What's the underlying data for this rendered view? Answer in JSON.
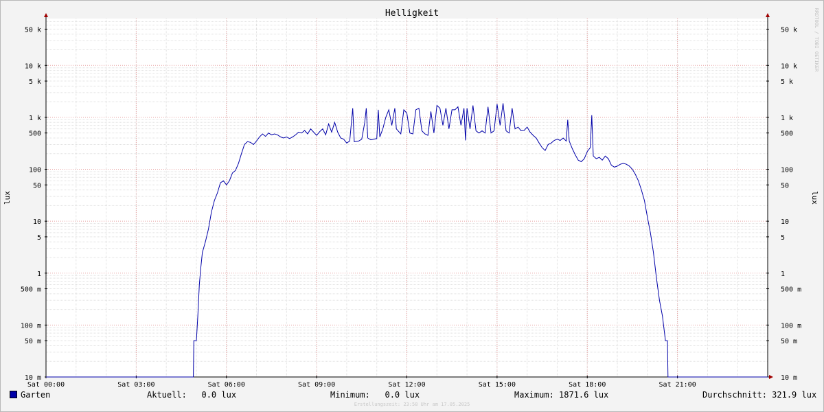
{
  "chart_data": {
    "type": "line",
    "title": "Helligkeit",
    "ylabel": "lux",
    "ylabel_right": "lux",
    "y_scale": "log",
    "ylim": [
      0.01,
      80000
    ],
    "xlim": [
      "00:00",
      "24:00"
    ],
    "x_ticks": [
      "Sat 00:00",
      "Sat 03:00",
      "Sat 06:00",
      "Sat 09:00",
      "Sat 12:00",
      "Sat 15:00",
      "Sat 18:00",
      "Sat 21:00"
    ],
    "x_tick_hours": [
      0,
      3,
      6,
      9,
      12,
      15,
      18,
      21
    ],
    "y_ticks": [
      {
        "value": 0.01,
        "label": "10 m"
      },
      {
        "value": 0.05,
        "label": "50 m"
      },
      {
        "value": 0.1,
        "label": "100 m"
      },
      {
        "value": 0.5,
        "label": "500 m"
      },
      {
        "value": 1,
        "label": "1"
      },
      {
        "value": 5,
        "label": "5"
      },
      {
        "value": 10,
        "label": "10"
      },
      {
        "value": 50,
        "label": "50"
      },
      {
        "value": 100,
        "label": "100"
      },
      {
        "value": 500,
        "label": "500"
      },
      {
        "value": 1000,
        "label": "1 k"
      },
      {
        "value": 5000,
        "label": "5 k"
      },
      {
        "value": 10000,
        "label": "10 k"
      },
      {
        "value": 50000,
        "label": "50 k"
      }
    ],
    "grid": true,
    "series": [
      {
        "name": "Garten",
        "color": "#0000a8",
        "points": [
          [
            "00:00",
            0.0
          ],
          [
            "04:54",
            0.0
          ],
          [
            "04:55",
            0.05
          ],
          [
            "05:00",
            0.05
          ],
          [
            "05:03",
            0.15
          ],
          [
            "05:06",
            0.6
          ],
          [
            "05:09",
            1.3
          ],
          [
            "05:12",
            2.5
          ],
          [
            "05:18",
            4
          ],
          [
            "05:24",
            7
          ],
          [
            "05:30",
            15
          ],
          [
            "05:36",
            25
          ],
          [
            "05:42",
            35
          ],
          [
            "05:48",
            55
          ],
          [
            "05:54",
            60
          ],
          [
            "06:00",
            50
          ],
          [
            "06:06",
            60
          ],
          [
            "06:12",
            85
          ],
          [
            "06:18",
            95
          ],
          [
            "06:24",
            130
          ],
          [
            "06:30",
            200
          ],
          [
            "06:36",
            300
          ],
          [
            "06:42",
            340
          ],
          [
            "06:48",
            330
          ],
          [
            "06:54",
            300
          ],
          [
            "07:00",
            350
          ],
          [
            "07:06",
            420
          ],
          [
            "07:12",
            480
          ],
          [
            "07:18",
            430
          ],
          [
            "07:24",
            500
          ],
          [
            "07:30",
            460
          ],
          [
            "07:36",
            480
          ],
          [
            "07:42",
            460
          ],
          [
            "07:48",
            420
          ],
          [
            "07:54",
            400
          ],
          [
            "08:00",
            420
          ],
          [
            "08:06",
            390
          ],
          [
            "08:12",
            420
          ],
          [
            "08:18",
            460
          ],
          [
            "08:24",
            520
          ],
          [
            "08:30",
            500
          ],
          [
            "08:36",
            560
          ],
          [
            "08:42",
            480
          ],
          [
            "08:48",
            600
          ],
          [
            "08:54",
            520
          ],
          [
            "09:00",
            450
          ],
          [
            "09:06",
            530
          ],
          [
            "09:12",
            600
          ],
          [
            "09:18",
            460
          ],
          [
            "09:24",
            750
          ],
          [
            "09:30",
            520
          ],
          [
            "09:36",
            800
          ],
          [
            "09:42",
            520
          ],
          [
            "09:48",
            400
          ],
          [
            "09:54",
            380
          ],
          [
            "10:00",
            320
          ],
          [
            "10:06",
            350
          ],
          [
            "10:12",
            1500
          ],
          [
            "10:15",
            340
          ],
          [
            "10:24",
            350
          ],
          [
            "10:30",
            380
          ],
          [
            "10:36",
            800
          ],
          [
            "10:39",
            1500
          ],
          [
            "10:42",
            400
          ],
          [
            "10:48",
            370
          ],
          [
            "10:54",
            380
          ],
          [
            "11:00",
            390
          ],
          [
            "11:03",
            1400
          ],
          [
            "11:06",
            420
          ],
          [
            "11:12",
            600
          ],
          [
            "11:18",
            1000
          ],
          [
            "11:24",
            1400
          ],
          [
            "11:30",
            700
          ],
          [
            "11:36",
            1500
          ],
          [
            "11:39",
            600
          ],
          [
            "11:48",
            480
          ],
          [
            "11:54",
            1400
          ],
          [
            "12:00",
            1200
          ],
          [
            "12:06",
            500
          ],
          [
            "12:12",
            480
          ],
          [
            "12:18",
            1400
          ],
          [
            "12:24",
            1500
          ],
          [
            "12:30",
            550
          ],
          [
            "12:36",
            480
          ],
          [
            "12:42",
            450
          ],
          [
            "12:48",
            1300
          ],
          [
            "12:54",
            500
          ],
          [
            "13:00",
            1700
          ],
          [
            "13:06",
            1500
          ],
          [
            "13:12",
            700
          ],
          [
            "13:18",
            1500
          ],
          [
            "13:24",
            600
          ],
          [
            "13:30",
            1400
          ],
          [
            "13:36",
            1400
          ],
          [
            "13:42",
            1600
          ],
          [
            "13:48",
            700
          ],
          [
            "13:54",
            1500
          ],
          [
            "13:57",
            360
          ],
          [
            "14:00",
            1500
          ],
          [
            "14:06",
            600
          ],
          [
            "14:12",
            1700
          ],
          [
            "14:18",
            550
          ],
          [
            "14:24",
            500
          ],
          [
            "14:30",
            550
          ],
          [
            "14:36",
            500
          ],
          [
            "14:42",
            1600
          ],
          [
            "14:48",
            500
          ],
          [
            "14:54",
            550
          ],
          [
            "15:00",
            1800
          ],
          [
            "15:06",
            700
          ],
          [
            "15:12",
            1870
          ],
          [
            "15:18",
            550
          ],
          [
            "15:24",
            500
          ],
          [
            "15:30",
            1500
          ],
          [
            "15:36",
            600
          ],
          [
            "15:42",
            650
          ],
          [
            "15:48",
            550
          ],
          [
            "15:54",
            560
          ],
          [
            "16:00",
            650
          ],
          [
            "16:06",
            520
          ],
          [
            "16:12",
            450
          ],
          [
            "16:18",
            400
          ],
          [
            "16:24",
            320
          ],
          [
            "16:30",
            260
          ],
          [
            "16:36",
            230
          ],
          [
            "16:42",
            300
          ],
          [
            "16:48",
            320
          ],
          [
            "16:54",
            360
          ],
          [
            "17:00",
            380
          ],
          [
            "17:06",
            360
          ],
          [
            "17:12",
            400
          ],
          [
            "17:18",
            350
          ],
          [
            "17:21",
            900
          ],
          [
            "17:24",
            350
          ],
          [
            "17:30",
            250
          ],
          [
            "17:36",
            190
          ],
          [
            "17:42",
            150
          ],
          [
            "17:48",
            140
          ],
          [
            "17:54",
            160
          ],
          [
            "18:00",
            220
          ],
          [
            "18:06",
            260
          ],
          [
            "18:09",
            1100
          ],
          [
            "18:12",
            180
          ],
          [
            "18:18",
            160
          ],
          [
            "18:24",
            170
          ],
          [
            "18:30",
            150
          ],
          [
            "18:36",
            180
          ],
          [
            "18:42",
            160
          ],
          [
            "18:48",
            120
          ],
          [
            "18:54",
            110
          ],
          [
            "19:00",
            115
          ],
          [
            "19:06",
            125
          ],
          [
            "19:12",
            130
          ],
          [
            "19:18",
            125
          ],
          [
            "19:24",
            115
          ],
          [
            "19:30",
            100
          ],
          [
            "19:36",
            80
          ],
          [
            "19:42",
            60
          ],
          [
            "19:48",
            40
          ],
          [
            "19:54",
            25
          ],
          [
            "20:00",
            12
          ],
          [
            "20:06",
            6
          ],
          [
            "20:12",
            2.5
          ],
          [
            "20:18",
            0.8
          ],
          [
            "20:24",
            0.3
          ],
          [
            "20:30",
            0.15
          ],
          [
            "20:36",
            0.05
          ],
          [
            "20:40",
            0.05
          ],
          [
            "20:41",
            0.0
          ],
          [
            "24:00",
            0.0
          ]
        ]
      }
    ],
    "legend": "bottom-left"
  },
  "legend": {
    "name": "Garten",
    "current": "Aktuell:   0.0 lux",
    "min": "Minimum:   0.0 lux",
    "max": "Maximum: 1871.6 lux",
    "avg": "Durchschnitt: 321.9 lux"
  },
  "watermark": "RRDTOOL / TOBI OETIKER",
  "footer": "Erstellungszeit: 23:58 Uhr am 17.05.2025"
}
